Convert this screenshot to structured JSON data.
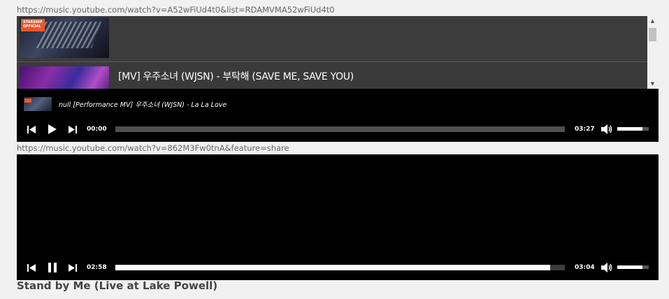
{
  "player1": {
    "url": "https://music.youtube.com/watch?v=A52wFiUd4t0&list=RDAMVMA52wFiUd4t0",
    "playlist": [
      {
        "title": "",
        "thumb_logo": "STARSHIP OFFICIAL"
      },
      {
        "title": "[MV] 우주소녀 (WJSN) - 부탁해 (SAVE ME, SAVE YOU)"
      }
    ],
    "now_playing": "null [Performance MV] 우주소녀 (WJSN) - La La Love",
    "current_time": "00:00",
    "duration": "03:27",
    "progress": 0,
    "volume": 0.8,
    "state": "paused",
    "play_icon": "play-icon"
  },
  "player2": {
    "url": "https://music.youtube.com/watch?v=862M3Fw0tnA&feature=share",
    "current_time": "02:58",
    "duration": "03:04",
    "progress": 0.967,
    "volume": 0.8,
    "state": "playing",
    "play_icon": "pause-icon",
    "title": "Stand by Me (Live at Lake Powell)"
  },
  "colors": {
    "page_bg": "#f1f1f1",
    "player_bg": "#000000",
    "playlist_bg": "#3a3a3a",
    "accent": "#ffffff"
  }
}
